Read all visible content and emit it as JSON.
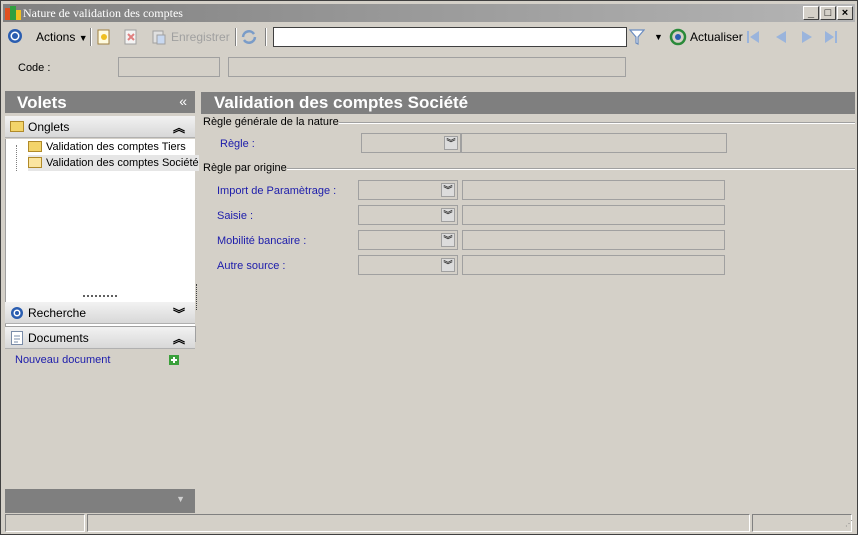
{
  "window": {
    "title": "Nature de validation des comptes"
  },
  "toolbar": {
    "actions_label": "Actions",
    "save_label": "Enregistrer",
    "refresh_label": "Actualiser",
    "search_value": ""
  },
  "code": {
    "label": "Code :",
    "value": "",
    "description": ""
  },
  "left_pane": {
    "title": "Volets",
    "onglets_label": "Onglets",
    "tree_items": [
      "Validation des comptes Tiers",
      "Validation des comptes Société"
    ],
    "recherche_label": "Recherche",
    "documents_label": "Documents",
    "new_document_label": "Nouveau document"
  },
  "main": {
    "title": "Validation des comptes Société",
    "general_group": "Règle générale de la nature",
    "regle_label": "Règle :",
    "origin_group": "Règle par origine",
    "origin_rows": [
      {
        "label": "Import de Paramètrage :",
        "value": "",
        "description": ""
      },
      {
        "label": "Saisie :",
        "value": "",
        "description": ""
      },
      {
        "label": "Mobilité bancaire :",
        "value": "",
        "description": ""
      },
      {
        "label": "Autre source :",
        "value": "",
        "description": ""
      }
    ]
  },
  "colors": {
    "header_gray": "#7f7f7f",
    "label_blue": "#1c1cab",
    "window_bg": "#d4d0c8"
  }
}
